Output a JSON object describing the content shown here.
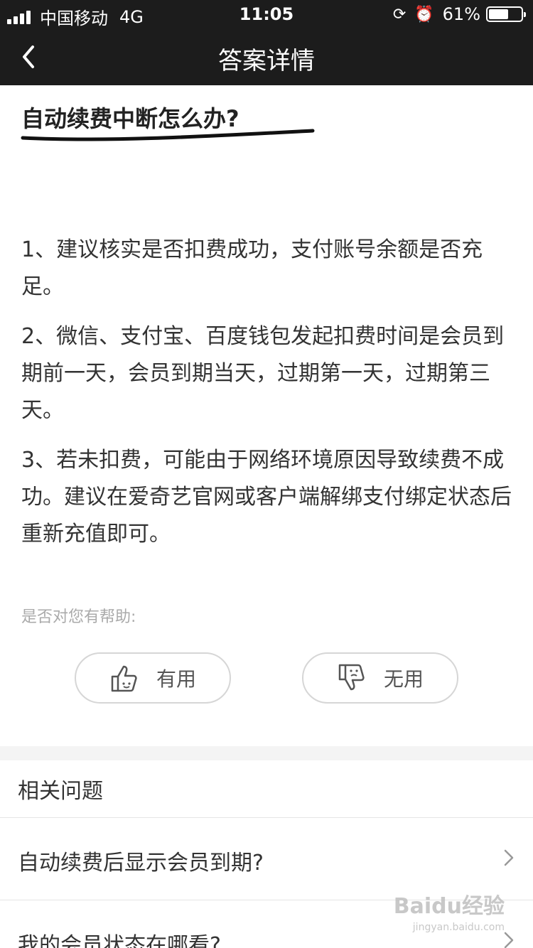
{
  "status_bar": {
    "carrier": "中国移动",
    "network": "4G",
    "time": "11:05",
    "battery_percent": "61%",
    "battery_level": 0.61
  },
  "nav": {
    "title": "答案详情",
    "back_icon": "chevron-left-icon"
  },
  "question": {
    "title": "自动续费中断怎么办?"
  },
  "answer": {
    "paragraphs": [
      "1、建议核实是否扣费成功，支付账号余额是否充足。",
      "2、微信、支付宝、百度钱包发起扣费时间是会员到期前一天，会员到期当天，过期第一天，过期第三天。",
      "3、若未扣费，可能由于网络环境原因导致续费不成功。建议在爱奇艺官网或客户端解绑支付绑定状态后重新充值即可。"
    ]
  },
  "feedback": {
    "prompt": "是否对您有帮助:",
    "useful_label": "有用",
    "useless_label": "无用"
  },
  "related": {
    "header": "相关问题",
    "items": [
      "自动续费后显示会员到期?",
      "我的会员状态在哪看?"
    ]
  },
  "watermark": {
    "text": "Baidu经验",
    "sub": "jingyan.baidu.com"
  },
  "colors": {
    "header_bg": "#1c1c1c",
    "text": "#333333",
    "muted": "#aaaaaa"
  }
}
